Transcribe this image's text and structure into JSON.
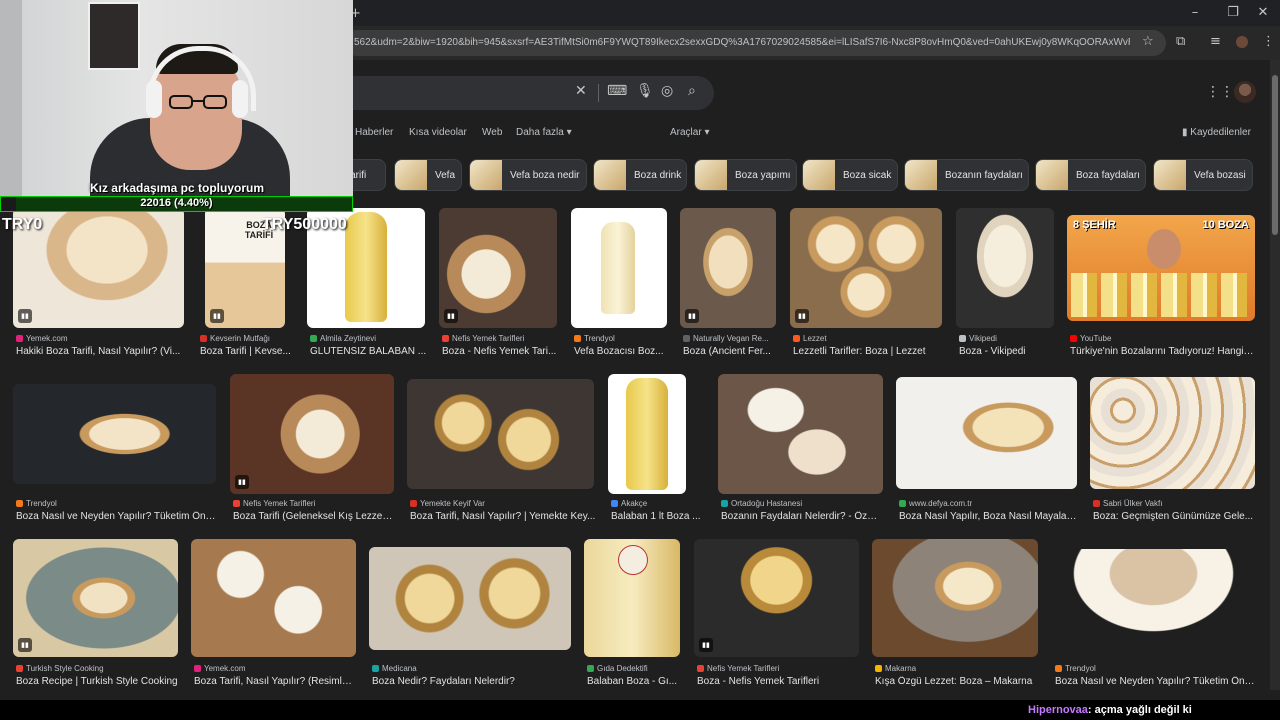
{
  "browser": {
    "url": "562&udm=2&biw=1920&bih=945&sxsrf=AE3TifMtSi0m6F9YWQT89Ikecx2sexxGDQ%3A1767029024585&ei=lLISafS7I6-Nxc8P8ovHmQ0&ved=0ahUKEwj0y8WKqOORAxWvRvEDHfLFMdM..."
  },
  "search": {
    "filters": [
      "Haberler",
      "Kısa videolar",
      "Web",
      "Daha fazla",
      "Araçlar"
    ],
    "saved_label": "Kaydedilenler",
    "chips": [
      "a tarifi",
      "Vefa",
      "Vefa boza nedir",
      "Boza drink",
      "Boza yapımı",
      "Boza sicak",
      "Bozanın faydaları",
      "Boza faydaları",
      "Vefa bozasi"
    ]
  },
  "results": {
    "row1": [
      {
        "source": "Yemek.com",
        "title": "Hakiki Boza Tarifi, Nasıl Yapılır? (Vi...",
        "video": true,
        "fav": "#e4207a"
      },
      {
        "source": "Kevserin Mutfağı",
        "title": "Boza Tarifi | Kevse...",
        "video": true,
        "fav": "#d93025",
        "overlay": "BOZA TARİFİ"
      },
      {
        "source": "Almila Zeytinevi",
        "title": "GLUTENSİZ BALABAN ...",
        "video": false,
        "fav": "#34a853"
      },
      {
        "source": "Nefis Yemek Tarifleri",
        "title": "Boza - Nefis Yemek Tari...",
        "video": true,
        "fav": "#e94235"
      },
      {
        "source": "Trendyol",
        "title": "Vefa Bozacısı Boz...",
        "video": false,
        "fav": "#f27a1a"
      },
      {
        "source": "Naturally Vegan Re...",
        "title": "Boza (Ancient Fer...",
        "video": true,
        "fav": "#5f6368"
      },
      {
        "source": "Lezzet",
        "title": "Lezzetli Tarifler: Boza | Lezzet",
        "video": true,
        "fav": "#ff5722"
      },
      {
        "source": "Vikipedi",
        "title": "Boza - Vikipedi",
        "video": false,
        "fav": "#bdc1c6"
      },
      {
        "source": "YouTube",
        "title": "Türkiye'nin Bozalarını Tadıyoruz! Hangis...",
        "video": false,
        "fav": "#ff0000",
        "overlay_left": "8 ŞEHİR",
        "overlay_right": "10 BOZA"
      }
    ],
    "row2": [
      {
        "source": "Trendyol",
        "title": "Boza Nasıl ve Neyden Yapılır? Tüketim Öne...",
        "video": false,
        "fav": "#f27a1a"
      },
      {
        "source": "Nefis Yemek Tarifleri",
        "title": "Boza Tarifi (Geleneksel Kış Lezzeti...",
        "video": true,
        "fav": "#e94235"
      },
      {
        "source": "Yemekte Keyif Var",
        "title": "Boza Tarifi, Nasıl Yapılır? | Yemekte Key...",
        "video": false,
        "fav": "#d93025"
      },
      {
        "source": "Akakçe",
        "title": "Balaban 1 lt Boza ...",
        "video": false,
        "fav": "#4285f4"
      },
      {
        "source": "Ortadoğu Hastanesi",
        "title": "Bozanın Faydaları Nelerdir? - Özel...",
        "video": false,
        "fav": "#1aa3a3"
      },
      {
        "source": "www.defya.com.tr",
        "title": "Boza Nasıl Yapılır, Boza Nasıl Mayalan...",
        "video": false,
        "fav": "#34a853"
      },
      {
        "source": "Sabri Ülker Vakfı",
        "title": "Boza: Geçmişten Günümüze Gele...",
        "video": false,
        "fav": "#d93025"
      }
    ],
    "row3": [
      {
        "source": "Turkish Style Cooking",
        "title": "Boza Recipe | Turkish Style Cooking",
        "video": true,
        "fav": "#e94235"
      },
      {
        "source": "Yemek.com",
        "title": "Boza Tarifi, Nasıl Yapılır? (Resimli ...",
        "video": false,
        "fav": "#e4207a"
      },
      {
        "source": "Medicana",
        "title": "Boza Nedir? Faydaları Nelerdir?",
        "video": false,
        "fav": "#1aa3a3"
      },
      {
        "source": "Gıda Dedektifi",
        "title": "Balaban Boza - Gı...",
        "video": false,
        "fav": "#34a853"
      },
      {
        "source": "Nefis Yemek Tarifleri",
        "title": "Boza - Nefis Yemek Tarifleri",
        "video": true,
        "fav": "#e94235"
      },
      {
        "source": "Makarna",
        "title": "Kışa Özgü Lezzet: Boza – Makarna",
        "video": false,
        "fav": "#f4b400"
      },
      {
        "source": "Trendyol",
        "title": "Boza Nasıl ve Neyden Yapılır? Tüketim Öne...",
        "video": false,
        "fav": "#f27a1a"
      }
    ]
  },
  "stream": {
    "goal_text": "Kız arkadaşıma pc topluyorum",
    "goal_count": "22016 (4.40%)",
    "goal_progress": 0.044,
    "label_left": "TRY0",
    "label_right": "TRY500000",
    "chat_user": "Hipernovaa",
    "chat_message": ": açma yağlı değil ki"
  },
  "colors": {
    "page_bg": "#1f1f1f",
    "goal_green": "#00d000",
    "chat_user": "#c47bff"
  }
}
